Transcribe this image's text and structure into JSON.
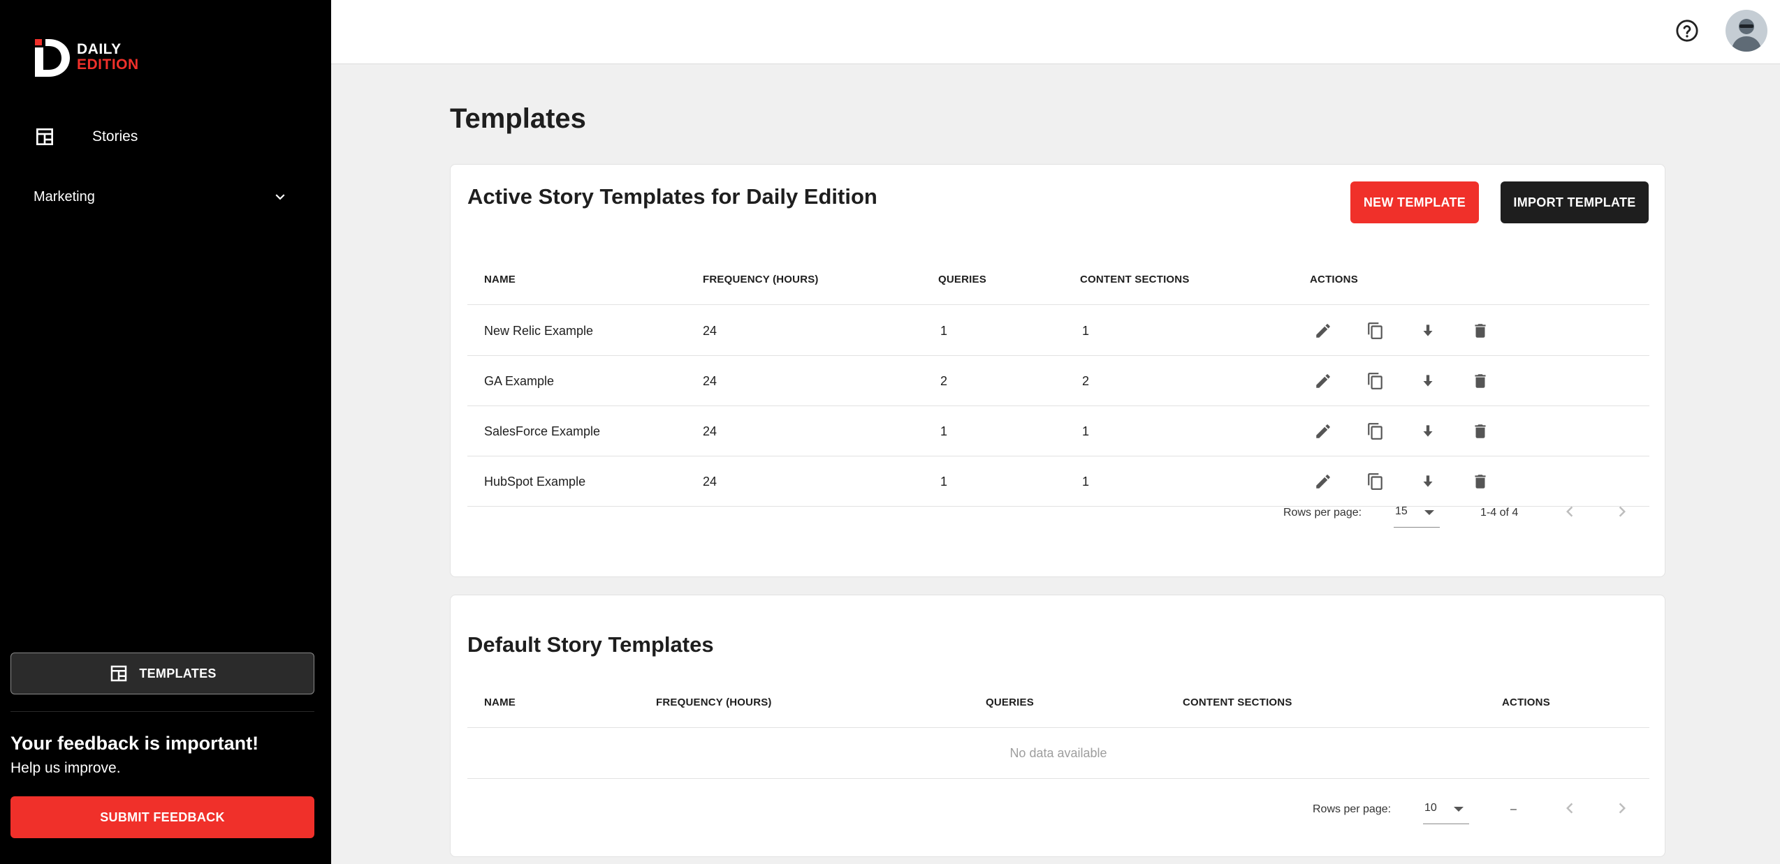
{
  "brand": {
    "line1": "DAILY",
    "line2": "EDITION",
    "accent": "#f0302a"
  },
  "sidebar": {
    "nav": [
      {
        "label": "Stories",
        "icon": "calendar-icon"
      }
    ],
    "group": {
      "label": "Marketing",
      "icon": "chevron-down-icon"
    },
    "templates_button": "TEMPLATES",
    "feedback_title": "Your feedback is important!",
    "feedback_subtitle": "Help us improve.",
    "feedback_button": "SUBMIT FEEDBACK"
  },
  "header": {
    "help_icon": "help-circle-icon",
    "avatar_icon": "user-avatar-icon"
  },
  "page": {
    "title": "Templates"
  },
  "active": {
    "title": "Active Story Templates for Daily Edition",
    "new_button": "NEW TEMPLATE",
    "import_button": "IMPORT TEMPLATE",
    "columns": [
      "NAME",
      "FREQUENCY (HOURS)",
      "QUERIES",
      "CONTENT SECTIONS",
      "ACTIONS"
    ],
    "rows": [
      {
        "name": "New Relic Example",
        "frequency": "24",
        "queries": "1",
        "sections": "1"
      },
      {
        "name": "GA Example",
        "frequency": "24",
        "queries": "2",
        "sections": "2"
      },
      {
        "name": "SalesForce Example",
        "frequency": "24",
        "queries": "1",
        "sections": "1"
      },
      {
        "name": "HubSpot Example",
        "frequency": "24",
        "queries": "1",
        "sections": "1"
      }
    ],
    "row_actions": [
      "edit-icon",
      "copy-icon",
      "download-icon",
      "delete-icon"
    ],
    "pager": {
      "label": "Rows per page:",
      "per_page": "15",
      "range": "1-4 of 4"
    }
  },
  "default": {
    "title": "Default Story Templates",
    "columns": [
      "NAME",
      "FREQUENCY (HOURS)",
      "QUERIES",
      "CONTENT SECTIONS",
      "ACTIONS"
    ],
    "empty": "No data available",
    "pager": {
      "label": "Rows per page:",
      "per_page": "10",
      "range": "–"
    }
  }
}
